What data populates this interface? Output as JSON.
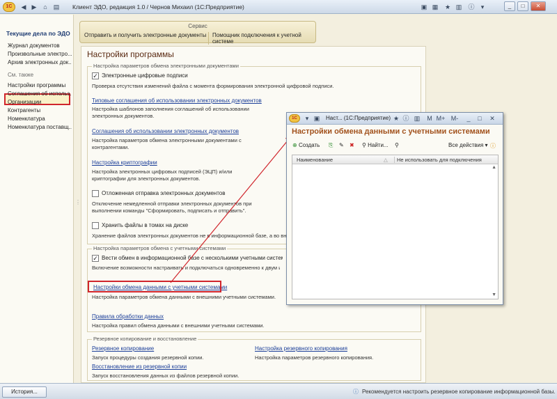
{
  "window": {
    "title": "Клиент ЭДО, редакция 1.0 / Чернов Михаил  (1С:Предприятие)",
    "logo": "1C"
  },
  "sidebar": {
    "header": "Текущие дела по ЭДО",
    "items": [
      "Журнал документов",
      "Произвольные электро...",
      "Архив электронных док..."
    ],
    "see_also": "См. также",
    "see_also_items": [
      "Настройки программы",
      "Соглашения об использ...",
      "Организации",
      "Контрагенты",
      "Номенклатура",
      "Номенклатура поставщ..."
    ]
  },
  "service": {
    "title": "Сервис",
    "links": [
      "Отправить и получить электронные документы",
      "Помощник подключения к учетной системе"
    ]
  },
  "main": {
    "title": "Настройки программы",
    "group1": {
      "title": "Настройка параметров обмена электронными документами",
      "chk_signatures": "Электронные цифровые подписи",
      "chk_signatures_desc": "Проверка отсутствия изменений файла с момента формирования электронной цифровой подписи.",
      "link_typical": "Типовые соглашения об использовании электронных документов",
      "link_typical_desc": "Настройка шаблонов заполнения соглашений об использовании электронных документов.",
      "link_agreements": "Соглашения об использовании электронных документов",
      "link_agreements_desc": "Настройка параметров обмена электронными документами с контрагентами.",
      "link_crypto": "Настройка криптографии",
      "link_crypto_desc": "Настройка электронных цифровых подписей (ЭЦП) и/или криптографии для электронных документов.",
      "chk_deferred": "Отложенная отправка электронных документов",
      "chk_deferred_desc": "Отключение немедленной отправки электронных документов при выполнении команды \"Сформировать, подписать и отправить\".",
      "chk_volumes": "Хранить файлы в томах на диске",
      "chk_volumes_desc": "Хранение файлов электронных документов не в информационной базе, а во внешних томах на диске."
    },
    "group2": {
      "title": "Настройка параметров обмена с учетными системами",
      "chk_exchange": "Вести обмен в информационной базе с несколькими учетными системами (до...",
      "chk_exchange_desc": "Включение возможности настраивать и подключаться одновременно к двум и более...",
      "link_exchange": "Настройки обмена данными с учетными системами",
      "link_exchange_desc": "Настройка параметров обмена данными с внешними учетными системами.",
      "link_rules": "Правила обработки данных",
      "link_rules_desc": "Настройка правил обмена данными с внешними учетными системами."
    },
    "group3": {
      "title": "Резервное копирование и восстановление",
      "link_backup": "Резервное копирование",
      "link_backup_desc": "Запуск процедуры создания резервной копии.",
      "link_backup_settings": "Настройка резервного копирования",
      "link_backup_settings_desc": "Настройка параметров резервного копирования.",
      "link_restore": "Восстановление из резервной копии",
      "link_restore_desc": "Запуск восстановления данных из файлов резервной копии."
    }
  },
  "popup": {
    "title": "Наст... (1С:Предприятие)",
    "header": "Настройки обмена данными с учетными системами",
    "create": "Создать",
    "find": "Найти...",
    "all_actions": "Все действия",
    "col_name": "Наименование",
    "col_disable": "Не использовать для подключения",
    "m_buttons": [
      "M",
      "M+",
      "M-"
    ]
  },
  "statusbar": {
    "history": "История...",
    "tip": "Рекомендуется настроить резервное копирование информационной базы."
  },
  "colors": {
    "highlight": "#d0252c",
    "link": "#1c3f99",
    "title": "#5a2a12",
    "popup_title": "#a2521d"
  }
}
